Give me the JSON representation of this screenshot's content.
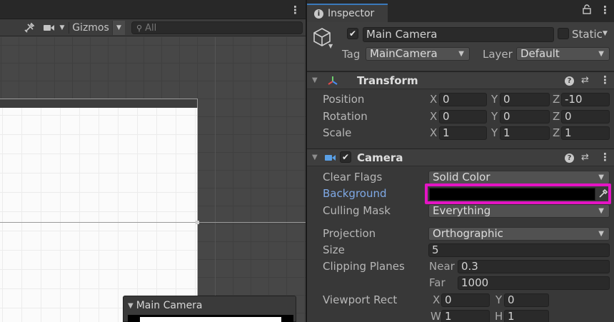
{
  "scene": {
    "toolbar": {
      "tools_icon": "tools-icon",
      "camera_icon": "camera-icon",
      "gizmos_label": "Gizmos",
      "search_placeholder": "All"
    },
    "camera_preview": {
      "title": "Main Camera"
    }
  },
  "inspector": {
    "tab_label": "Inspector",
    "gameobject": {
      "name": "Main Camera",
      "active": true,
      "static_label": "Static",
      "tag_label": "Tag",
      "tag_value": "MainCamera",
      "layer_label": "Layer",
      "layer_value": "Default"
    },
    "transform": {
      "title": "Transform",
      "position_label": "Position",
      "rotation_label": "Rotation",
      "scale_label": "Scale",
      "x": "X",
      "y": "Y",
      "z": "Z",
      "position": {
        "x": "0",
        "y": "0",
        "z": "-10"
      },
      "rotation": {
        "x": "0",
        "y": "0",
        "z": "0"
      },
      "scale": {
        "x": "1",
        "y": "1",
        "z": "1"
      }
    },
    "camera": {
      "title": "Camera",
      "enabled": true,
      "clear_flags_label": "Clear Flags",
      "clear_flags_value": "Solid Color",
      "background_label": "Background",
      "background_color": "#000000",
      "highlight_color": "#e414c4",
      "culling_mask_label": "Culling Mask",
      "culling_mask_value": "Everything",
      "projection_label": "Projection",
      "projection_value": "Orthographic",
      "size_label": "Size",
      "size_value": "5",
      "clipping_label": "Clipping Planes",
      "near_label": "Near",
      "near_value": "0.3",
      "far_label": "Far",
      "far_value": "1000",
      "viewport_label": "Viewport Rect",
      "x_label": "X",
      "y_label": "Y",
      "w_label": "W",
      "h_label": "H",
      "vp_x": "0",
      "vp_y": "0",
      "vp_w": "1",
      "vp_h": "1"
    }
  }
}
